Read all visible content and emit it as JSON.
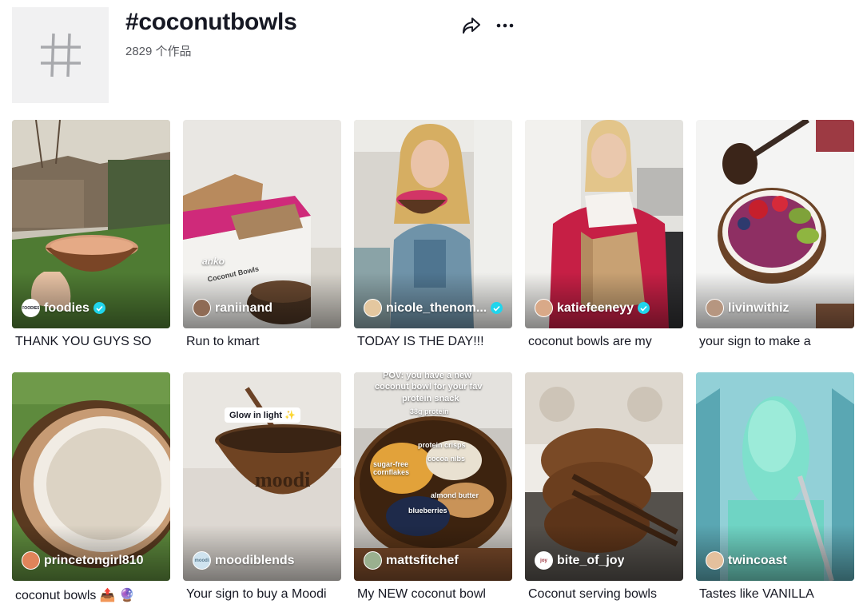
{
  "hashtag": {
    "title": "#coconutbowls",
    "count": "2829 个作品",
    "icon": "hashtag-icon"
  },
  "actions": {
    "share_icon": "share-icon",
    "more_icon": "more-icon"
  },
  "videos": [
    {
      "username": "foodies",
      "verified": true,
      "caption": "THANK YOU GUYS SO",
      "avatar_text": "FOODIES"
    },
    {
      "username": "raniinand",
      "verified": false,
      "caption": "Run to kmart",
      "avatar_text": ""
    },
    {
      "username": "nicole_thenom...",
      "verified": true,
      "caption": "TODAY IS THE DAY!!!",
      "avatar_text": ""
    },
    {
      "username": "katiefeeneyy",
      "verified": true,
      "caption": "coconut bowls are my",
      "avatar_text": ""
    },
    {
      "username": "livinwithiz",
      "verified": false,
      "caption": "your sign to make a",
      "avatar_text": ""
    },
    {
      "username": "princetongirl810",
      "verified": false,
      "caption": "coconut bowls 📤 🔮",
      "avatar_text": ""
    },
    {
      "username": "moodiblends",
      "verified": false,
      "caption": "Your sign to buy a Moodi",
      "avatar_text": "moodi"
    },
    {
      "username": "mattsfitchef",
      "verified": false,
      "caption": "My NEW coconut bowl",
      "avatar_text": ""
    },
    {
      "username": "bite_of_joy",
      "verified": false,
      "caption": "Coconut serving bowls",
      "avatar_text": "joy"
    },
    {
      "username": "twincoast",
      "verified": false,
      "caption": "Tastes like VANILLA",
      "avatar_text": ""
    }
  ],
  "overlays": {
    "kmart_brand": "anko",
    "kmart_box": "Coconut Bowls",
    "moodi_pill": "Glow in light ✨",
    "moodi_bowl": "moodi",
    "pov_line1": "POV: you have a new",
    "pov_line2": "coconut bowl for your fav",
    "pov_line3": "protein snack",
    "pov_protein": "38g protein",
    "pov_crisps": "protein crisps",
    "pov_nibs": "cocoa nibs",
    "pov_cornflakes": "sugar-free cornflakes",
    "pov_almond": "almond butter",
    "pov_blueberries": "blueberries"
  }
}
